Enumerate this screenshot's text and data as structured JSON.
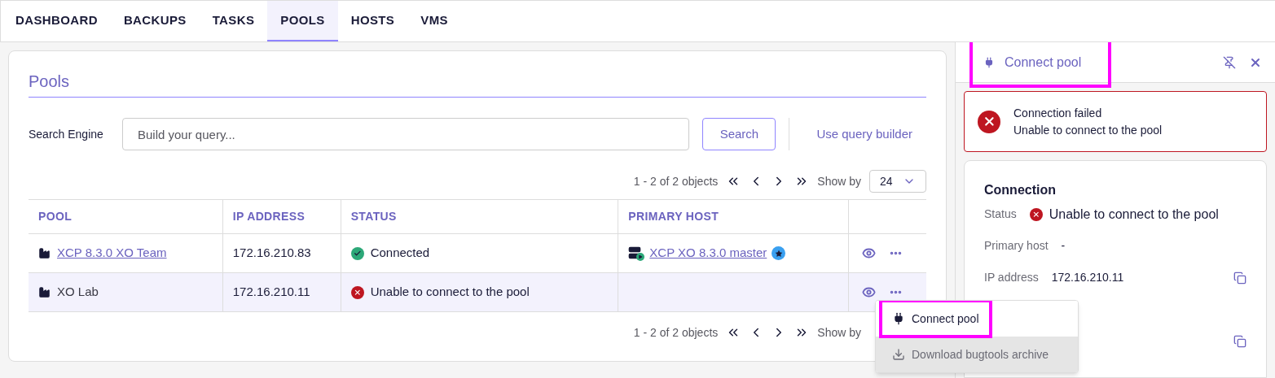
{
  "nav_tabs": [
    {
      "label": "DASHBOARD",
      "selected": false
    },
    {
      "label": "BACKUPS",
      "selected": false
    },
    {
      "label": "TASKS",
      "selected": false
    },
    {
      "label": "POOLS",
      "selected": true
    },
    {
      "label": "HOSTS",
      "selected": false
    },
    {
      "label": "VMS",
      "selected": false
    }
  ],
  "pools_panel": {
    "title": "Pools",
    "search": {
      "label": "Search Engine",
      "placeholder": "Build your query...",
      "button": "Search",
      "query_builder_link": "Use query builder"
    },
    "pagination_top": {
      "range": "1 - 2 of 2 objects",
      "show_by_label": "Show by",
      "show_by_value": "24"
    },
    "table": {
      "columns": [
        "POOL",
        "IP ADDRESS",
        "STATUS",
        "PRIMARY HOST"
      ],
      "rows": [
        {
          "pool": "XCP 8.3.0 XO Team",
          "pool_is_link": true,
          "ip": "172.16.210.83",
          "status": {
            "kind": "connected",
            "text": "Connected"
          },
          "primary_host": "XCP XO 8.3.0 master",
          "primary_host_master": true,
          "selected": false
        },
        {
          "pool": "XO Lab",
          "pool_is_link": false,
          "ip": "172.16.210.11",
          "status": {
            "kind": "error",
            "text": "Unable to connect to the pool"
          },
          "selected": true
        }
      ]
    },
    "pagination_bottom": {
      "range": "1 - 2 of 2 objects",
      "show_by_label": "Show by"
    }
  },
  "row_menu": {
    "items": [
      {
        "kind": "connect",
        "label": "Connect pool",
        "disabled": false,
        "highlighted": true
      },
      {
        "kind": "download",
        "label": "Download bugtools archive",
        "disabled": true,
        "highlighted": false
      }
    ]
  },
  "side_panel": {
    "title": "Connect pool",
    "alert": {
      "title": "Connection failed",
      "message": "Unable to connect to the pool"
    },
    "connection": {
      "title": "Connection",
      "fields": [
        {
          "kind": "status",
          "label": "Status",
          "value": "Unable to connect to the pool"
        },
        {
          "kind": "text",
          "label": "Primary host",
          "value": "-"
        },
        {
          "kind": "text",
          "label": "IP address",
          "value": "172.16.210.11",
          "copyable": true
        },
        {
          "kind": "covered"
        },
        {
          "kind": "covered",
          "copyable": true
        }
      ]
    }
  }
}
